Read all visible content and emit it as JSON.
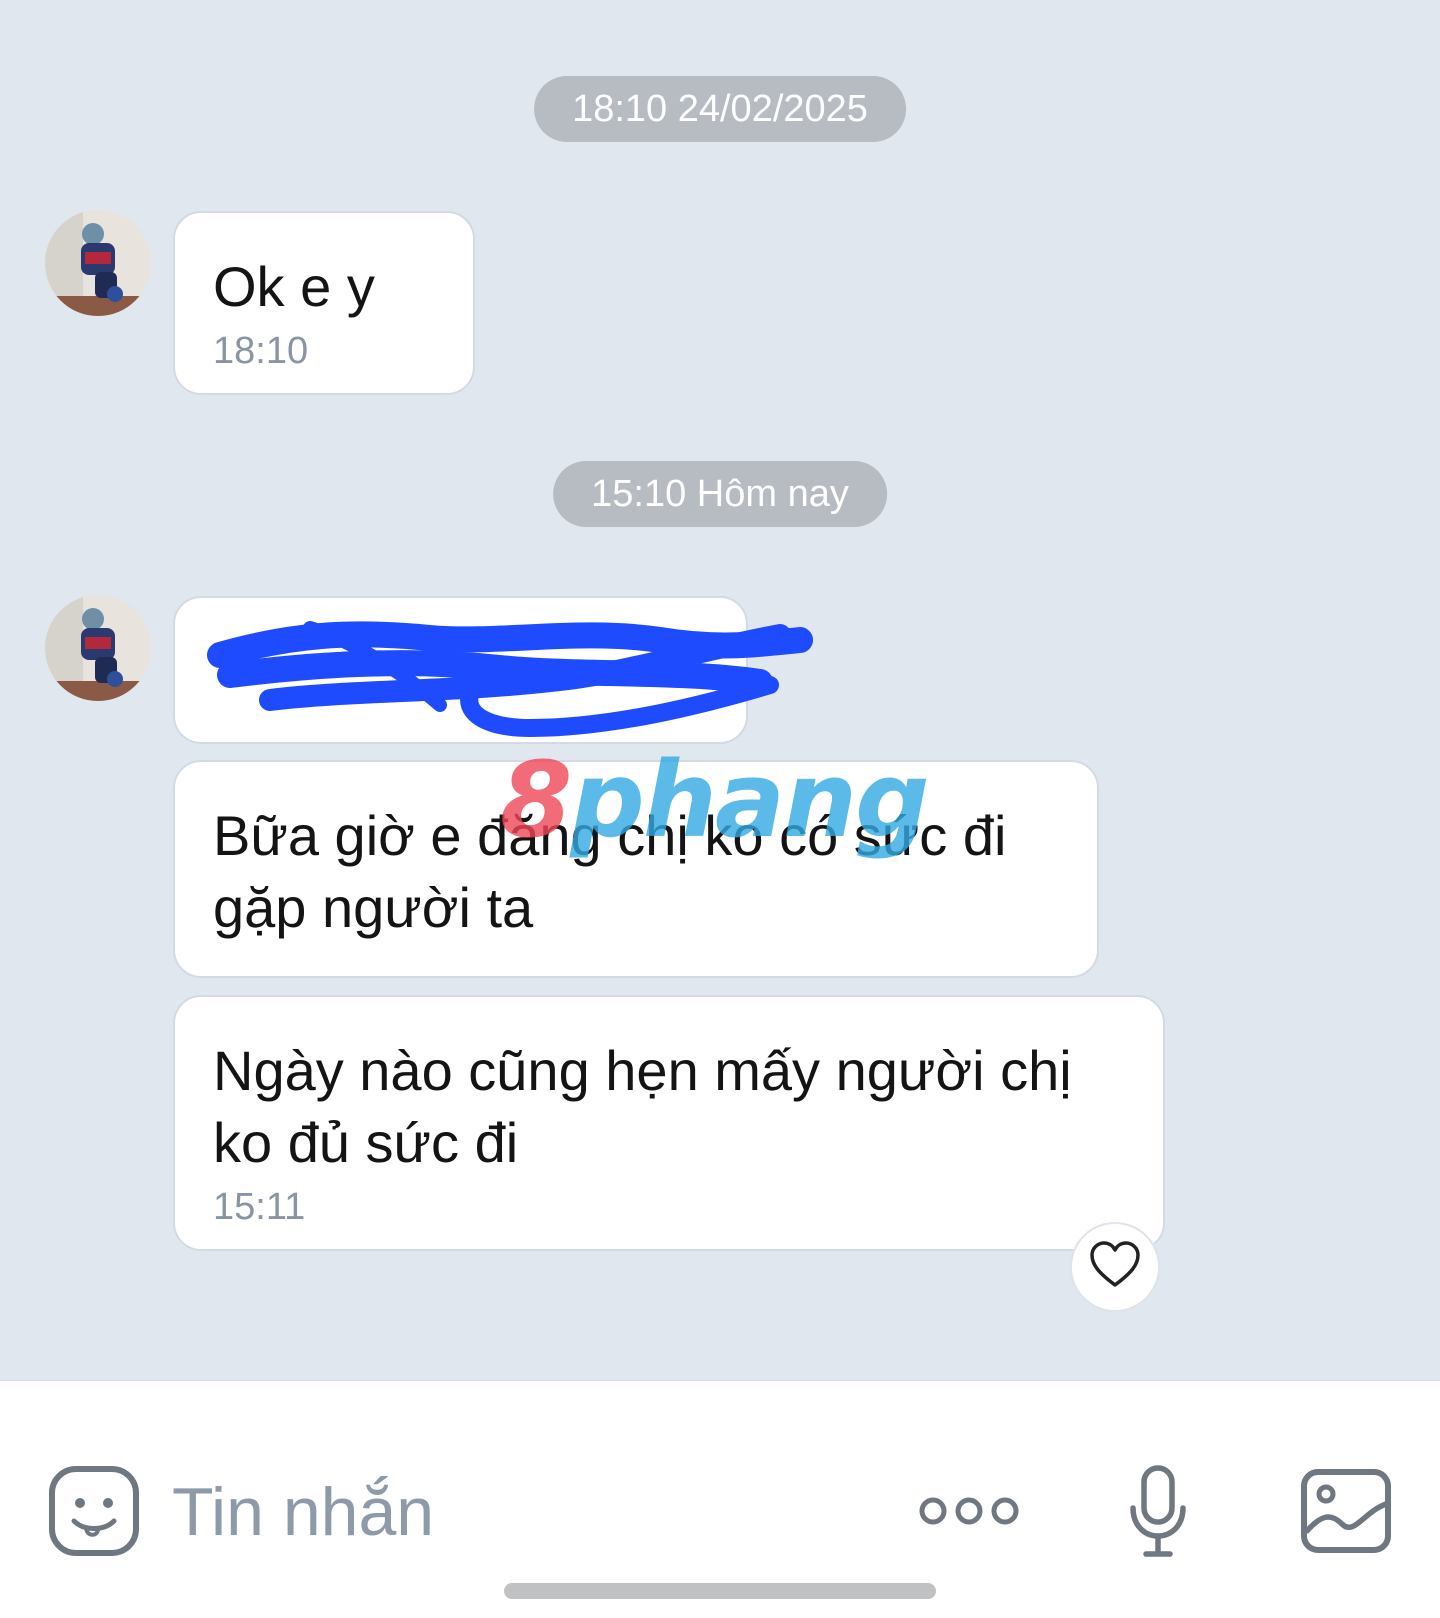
{
  "colors": {
    "chat_background": "#e1e7ef",
    "bubble_background": "#ffffff",
    "time_pill": "#b7bcc2",
    "redaction_scribble": "#1f4bff",
    "icon_gray": "#6f7780"
  },
  "conversation": {
    "separators": [
      {
        "label": "18:10 24/02/2025"
      },
      {
        "label": "15:10 Hôm nay"
      }
    ],
    "messages": [
      {
        "text": "Ok e y",
        "time": "18:10"
      },
      {
        "text": "",
        "redacted": true
      },
      {
        "text": "Bữa giờ e đăng chị ko có sức đi gặp người ta"
      },
      {
        "text": "Ngày nào cũng hẹn mấy người chị ko đủ sức đi",
        "time": "15:11"
      }
    ]
  },
  "watermark": {
    "part1": "8",
    "part2": "phang"
  },
  "reaction": {
    "icon": "heart-icon"
  },
  "composer": {
    "placeholder": "Tin nhắn",
    "icons": [
      "sticker-icon",
      "more-dots-icon",
      "microphone-icon",
      "image-icon"
    ]
  }
}
